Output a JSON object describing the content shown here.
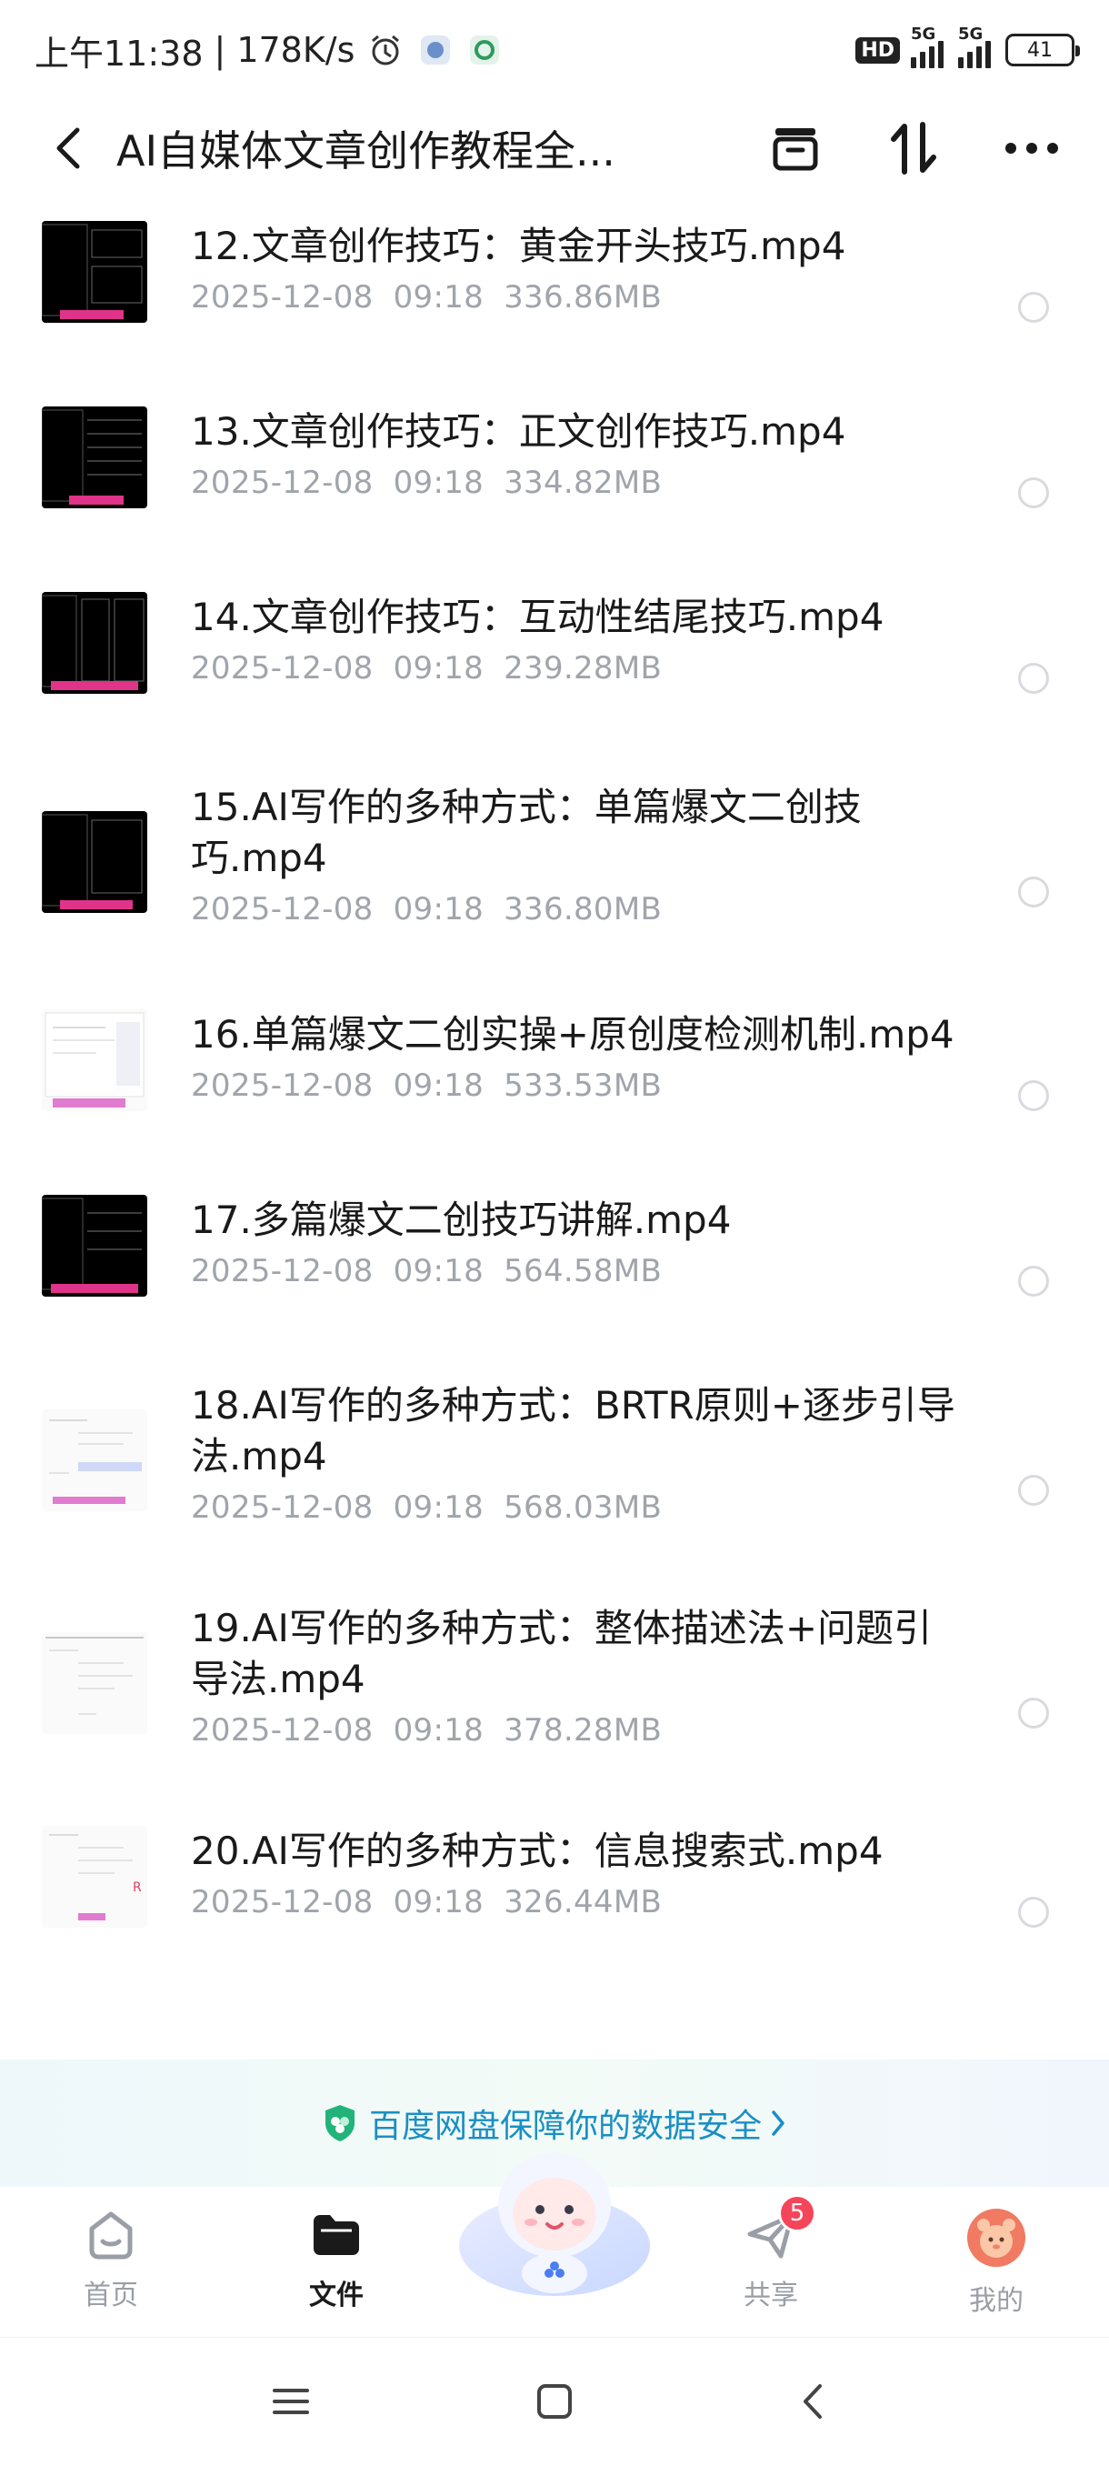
{
  "status_bar": {
    "time": "上午11:38",
    "net_speed": "178K/s",
    "hd_label": "HD",
    "sim1_label": "5G",
    "sim2_label": "5G",
    "battery": "41"
  },
  "header": {
    "title": "AI自媒体文章创作教程全...",
    "back_icon": "chevron-left-icon",
    "icons": [
      "archive-icon",
      "sort-icon",
      "more-icon"
    ]
  },
  "files": [
    {
      "name": "12.文章创作技巧：黄金开头技巧.mp4",
      "date": "2025-12-08",
      "time": "09:18",
      "size": "336.86MB",
      "thumb": "dark"
    },
    {
      "name": "13.文章创作技巧：正文创作技巧.mp4",
      "date": "2025-12-08",
      "time": "09:18",
      "size": "334.82MB",
      "thumb": "dark"
    },
    {
      "name": "14.文章创作技巧：互动性结尾技巧.mp4",
      "date": "2025-12-08",
      "time": "09:18",
      "size": "239.28MB",
      "thumb": "dark"
    },
    {
      "name": "15.AI写作的多种方式：单篇爆文二创技巧.mp4",
      "date": "2025-12-08",
      "time": "09:18",
      "size": "336.80MB",
      "thumb": "dark"
    },
    {
      "name": "16.单篇爆文二创实操+原创度检测机制.mp4",
      "date": "2025-12-08",
      "time": "09:18",
      "size": "533.53MB",
      "thumb": "light"
    },
    {
      "name": "17.多篇爆文二创技巧讲解.mp4",
      "date": "2025-12-08",
      "time": "09:18",
      "size": "564.58MB",
      "thumb": "dark"
    },
    {
      "name": "18.AI写作的多种方式：BRTR原则+逐步引导法.mp4",
      "date": "2025-12-08",
      "time": "09:18",
      "size": "568.03MB",
      "thumb": "light"
    },
    {
      "name": "19.AI写作的多种方式：整体描述法+问题引导法.mp4",
      "date": "2025-12-08",
      "time": "09:18",
      "size": "378.28MB",
      "thumb": "light"
    },
    {
      "name": "20.AI写作的多种方式：信息搜索式.mp4",
      "date": "2025-12-08",
      "time": "09:18",
      "size": "326.44MB",
      "thumb": "light"
    }
  ],
  "banner": {
    "text": "百度网盘保障你的数据安全",
    "icon": "shield-icon"
  },
  "bottom_nav": {
    "items": [
      {
        "label": "首页",
        "icon": "home-icon",
        "active": false
      },
      {
        "label": "文件",
        "icon": "folder-icon",
        "active": true
      },
      {
        "label": "共享",
        "icon": "paper-plane-icon",
        "active": false,
        "badge": "5"
      },
      {
        "label": "我的",
        "icon": "avatar-icon",
        "active": false
      }
    ]
  },
  "colors": {
    "accent": "#1a8fc4",
    "badge": "#f5455a",
    "meta_text": "#a0a4ab"
  }
}
